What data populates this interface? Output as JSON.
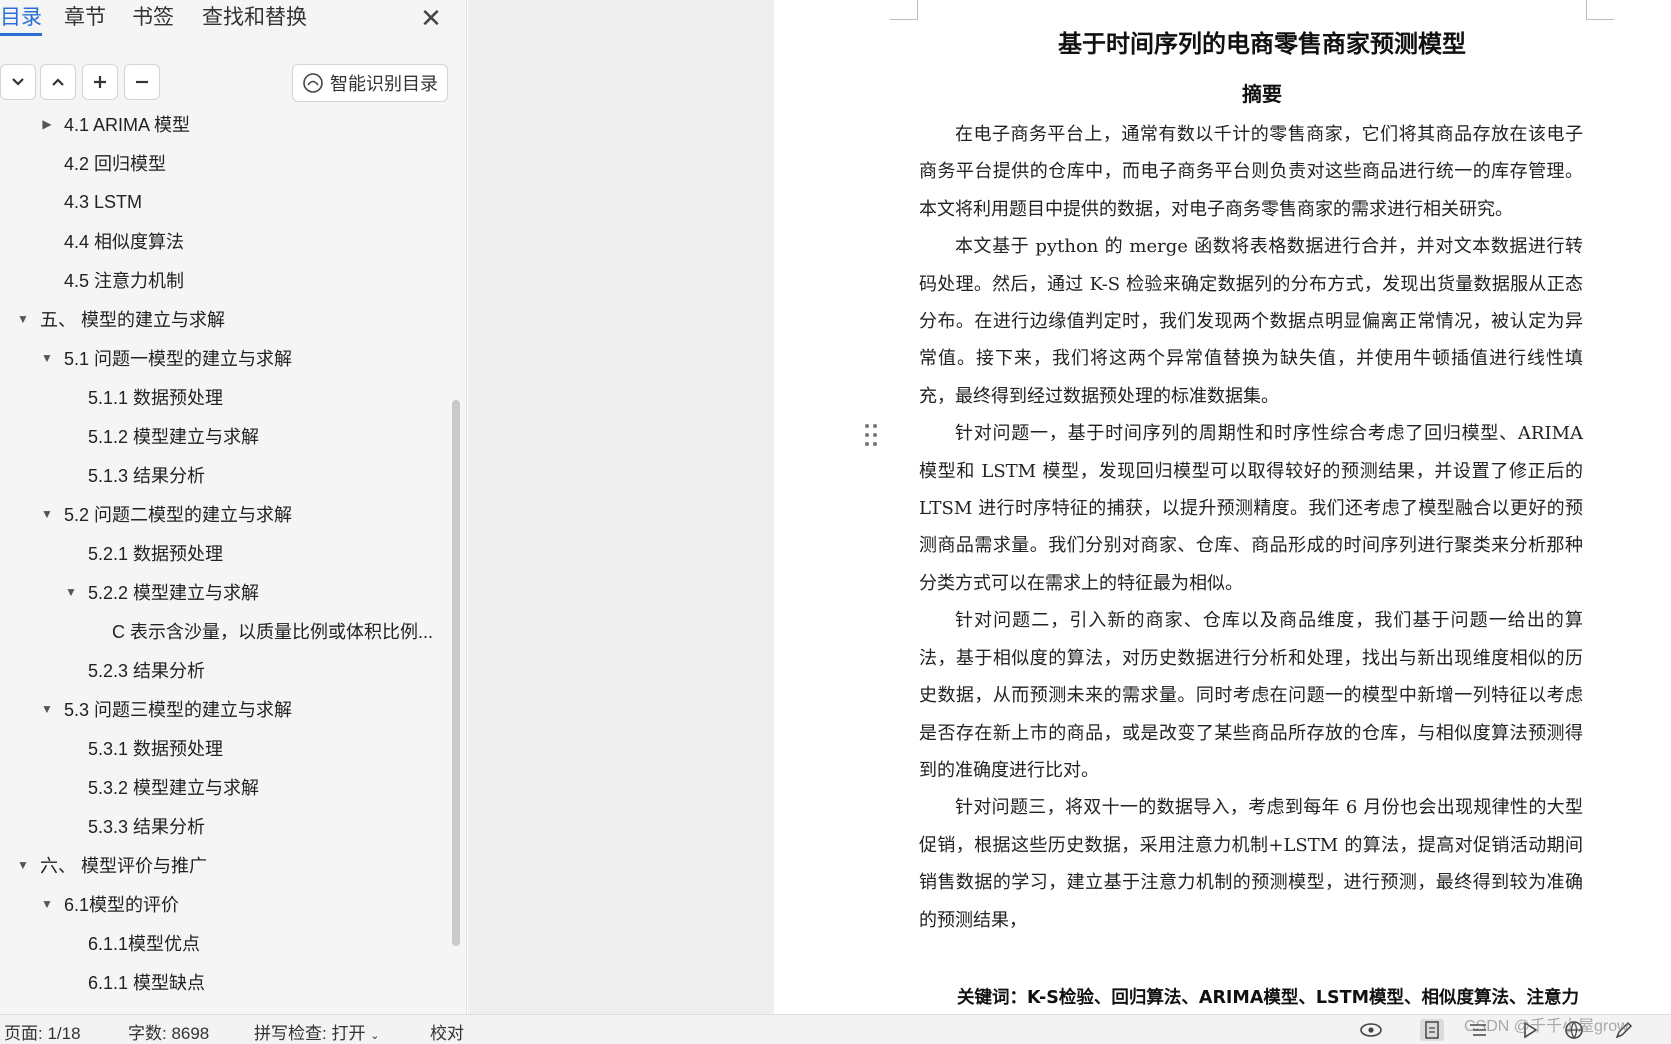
{
  "nav": {
    "tabs": [
      {
        "label": "目录"
      },
      {
        "label": "章节"
      },
      {
        "label": "书签"
      },
      {
        "label": "查找和替换"
      }
    ],
    "smart_toc_label": "智能识别目录",
    "toc": [
      {
        "label": "4.1 ARIMA 模型",
        "caret": "right"
      },
      {
        "label": "4.2 回归模型",
        "caret": ""
      },
      {
        "label": "4.3 LSTM",
        "caret": ""
      },
      {
        "label": "4.4  相似度算法",
        "caret": ""
      },
      {
        "label": "4.5  注意力机制",
        "caret": ""
      },
      {
        "label": "五、  模型的建立与求解",
        "caret": "down"
      },
      {
        "label": "5.1  问题一模型的建立与求解",
        "caret": "down"
      },
      {
        "label": "5.1.1 数据预处理",
        "caret": ""
      },
      {
        "label": "5.1.2 模型建立与求解",
        "caret": ""
      },
      {
        "label": "5.1.3 结果分析",
        "caret": ""
      },
      {
        "label": "5.2  问题二模型的建立与求解",
        "caret": "down"
      },
      {
        "label": "5.2.1 数据预处理",
        "caret": ""
      },
      {
        "label": "5.2.2 模型建立与求解",
        "caret": "down"
      },
      {
        "label": "C  表示含沙量，以质量比例或体积比例...",
        "caret": ""
      },
      {
        "label": "5.2.3 结果分析",
        "caret": ""
      },
      {
        "label": "5.3  问题三模型的建立与求解",
        "caret": "down"
      },
      {
        "label": "5.3.1 数据预处理",
        "caret": ""
      },
      {
        "label": "5.3.2 模型建立与求解",
        "caret": ""
      },
      {
        "label": "5.3.3 结果分析",
        "caret": ""
      },
      {
        "label": "六、  模型评价与推广",
        "caret": "down"
      },
      {
        "label": "6.1模型的评价",
        "caret": "down"
      },
      {
        "label": "6.1.1模型优点",
        "caret": ""
      },
      {
        "label": "6.1.1  模型缺点",
        "caret": ""
      }
    ]
  },
  "document": {
    "title": "基于时间序列的电商零售商家预测模型",
    "abstract_heading": "摘要",
    "paragraphs": [
      "在电子商务平台上，通常有数以千计的零售商家，它们将其商品存放在该电子商务平台提供的仓库中，而电子商务平台则负责对这些商品进行统一的库存管理。本文将利用题目中提供的数据，对电子商务零售商家的需求进行相关研究。",
      "本文基于 python 的 merge 函数将表格数据进行合并，并对文本数据进行转码处理。然后，通过 K-S 检验来确定数据列的分布方式，发现出货量数据服从正态分布。在进行边缘值判定时，我们发现两个数据点明显偏离正常情况，被认定为异常值。接下来，我们将这两个异常值替换为缺失值，并使用牛顿插值进行线性填充，最终得到经过数据预处理的标准数据集。",
      "针对问题一，基于时间序列的周期性和时序性综合考虑了回归模型、ARIMA 模型和 LSTM 模型，发现回归模型可以取得较好的预测结果，并设置了修正后的 LTSM 进行时序特征的捕获，以提升预测精度。我们还考虑了模型融合以更好的预测商品需求量。我们分别对商家、仓库、商品形成的时间序列进行聚类来分析那种分类方式可以在需求上的特征最为相似。",
      "针对问题二，引入新的商家、仓库以及商品维度，我们基于问题一给出的算法，基于相似度的算法，对历史数据进行分析和处理，找出与新出现维度相似的历史数据，从而预测未来的需求量。同时考虑在问题一的模型中新增一列特征以考虑是否存在新上市的商品，或是改变了某些商品所存放的仓库，与相似度算法预测得到的准确度进行比对。",
      "针对问题三，将双十一的数据导入，考虑到每年 6 月份也会出现规律性的大型促销，根据这些历史数据，采用注意力机制+LSTM 的算法，提高对促销活动期间销售数据的学习，建立基于注意力机制的预测模型，进行预测，最终得到较为准确的预测结果，"
    ],
    "keywords": "关键词：K-S检验、回归算法、ARIMA模型、LSTM模型、相似度算法、注意力"
  },
  "status": {
    "page": "页面: 1/18",
    "word_count": "字数: 8698",
    "spell_check": "拼写检查: 打开",
    "proofread": "校对"
  },
  "watermark": "CSDN @千千小屋grow",
  "colors": {
    "accent": "#2b6fd6",
    "pane_bg": "#f5f5f5",
    "gutter_bg": "#efefef"
  },
  "icons": [
    "close-icon",
    "chevron-down-icon",
    "chevron-up-icon",
    "plus-icon",
    "minus-icon",
    "smart-toc-icon",
    "eye-icon",
    "page-view-icon",
    "outline-view-icon",
    "play-icon",
    "globe-icon",
    "pen-icon"
  ]
}
